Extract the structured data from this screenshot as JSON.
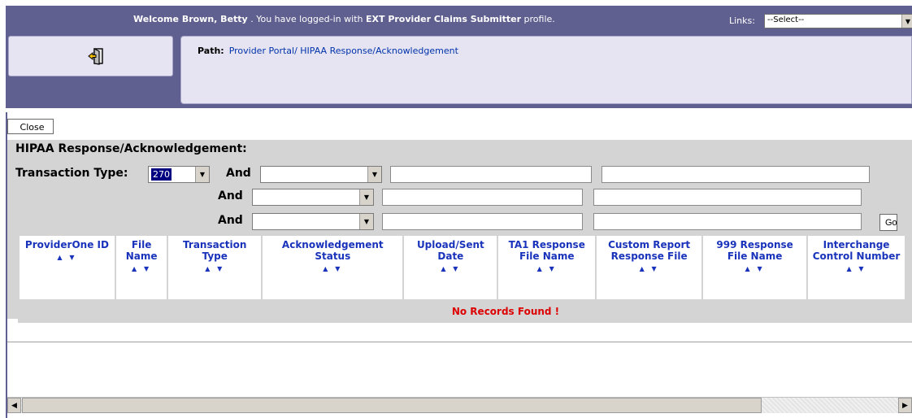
{
  "header": {
    "welcome_prefix": "Welcome ",
    "user_name": "Brown, Betty",
    "welcome_middle": " . You have logged-in with ",
    "profile_name": "EXT Provider Claims Submitter",
    "welcome_suffix": " profile.",
    "links_label": "Links:",
    "links_value": "--Select--"
  },
  "path": {
    "label": "Path:",
    "value": "Provider Portal/ HIPAA Response/Acknowledgement"
  },
  "close_label": "Close",
  "section_title": "HIPAA Response/Acknowledgement:",
  "filters": {
    "transaction_type_label": "Transaction Type:",
    "transaction_type_value": "270",
    "and_label": "And",
    "go_label": "Go"
  },
  "table": {
    "columns": [
      {
        "label": "ProviderOne ID"
      },
      {
        "label": "File Name"
      },
      {
        "label": "Transaction Type"
      },
      {
        "label": "Acknowledgement Status"
      },
      {
        "label": "Upload/Sent Date"
      },
      {
        "label": "TA1 Response File Name"
      },
      {
        "label": "Custom Report Response File"
      },
      {
        "label": "999 Response File Name"
      },
      {
        "label": "Interchange Control Number"
      }
    ],
    "sort_glyph": "▲ ▼",
    "empty_message": "No Records Found !"
  },
  "icons": {
    "exit": "exit-door-icon",
    "dropdown": "chevron-down-icon",
    "scroll_left": "arrow-left-icon",
    "scroll_right": "arrow-right-icon"
  },
  "colors": {
    "header_bg": "#606090",
    "panel_bg": "#e6e4f2",
    "link_blue": "#0033aa",
    "column_header_text": "#1a33bb",
    "empty_message": "#dd0000",
    "filter_bg": "#d4d4d4"
  }
}
